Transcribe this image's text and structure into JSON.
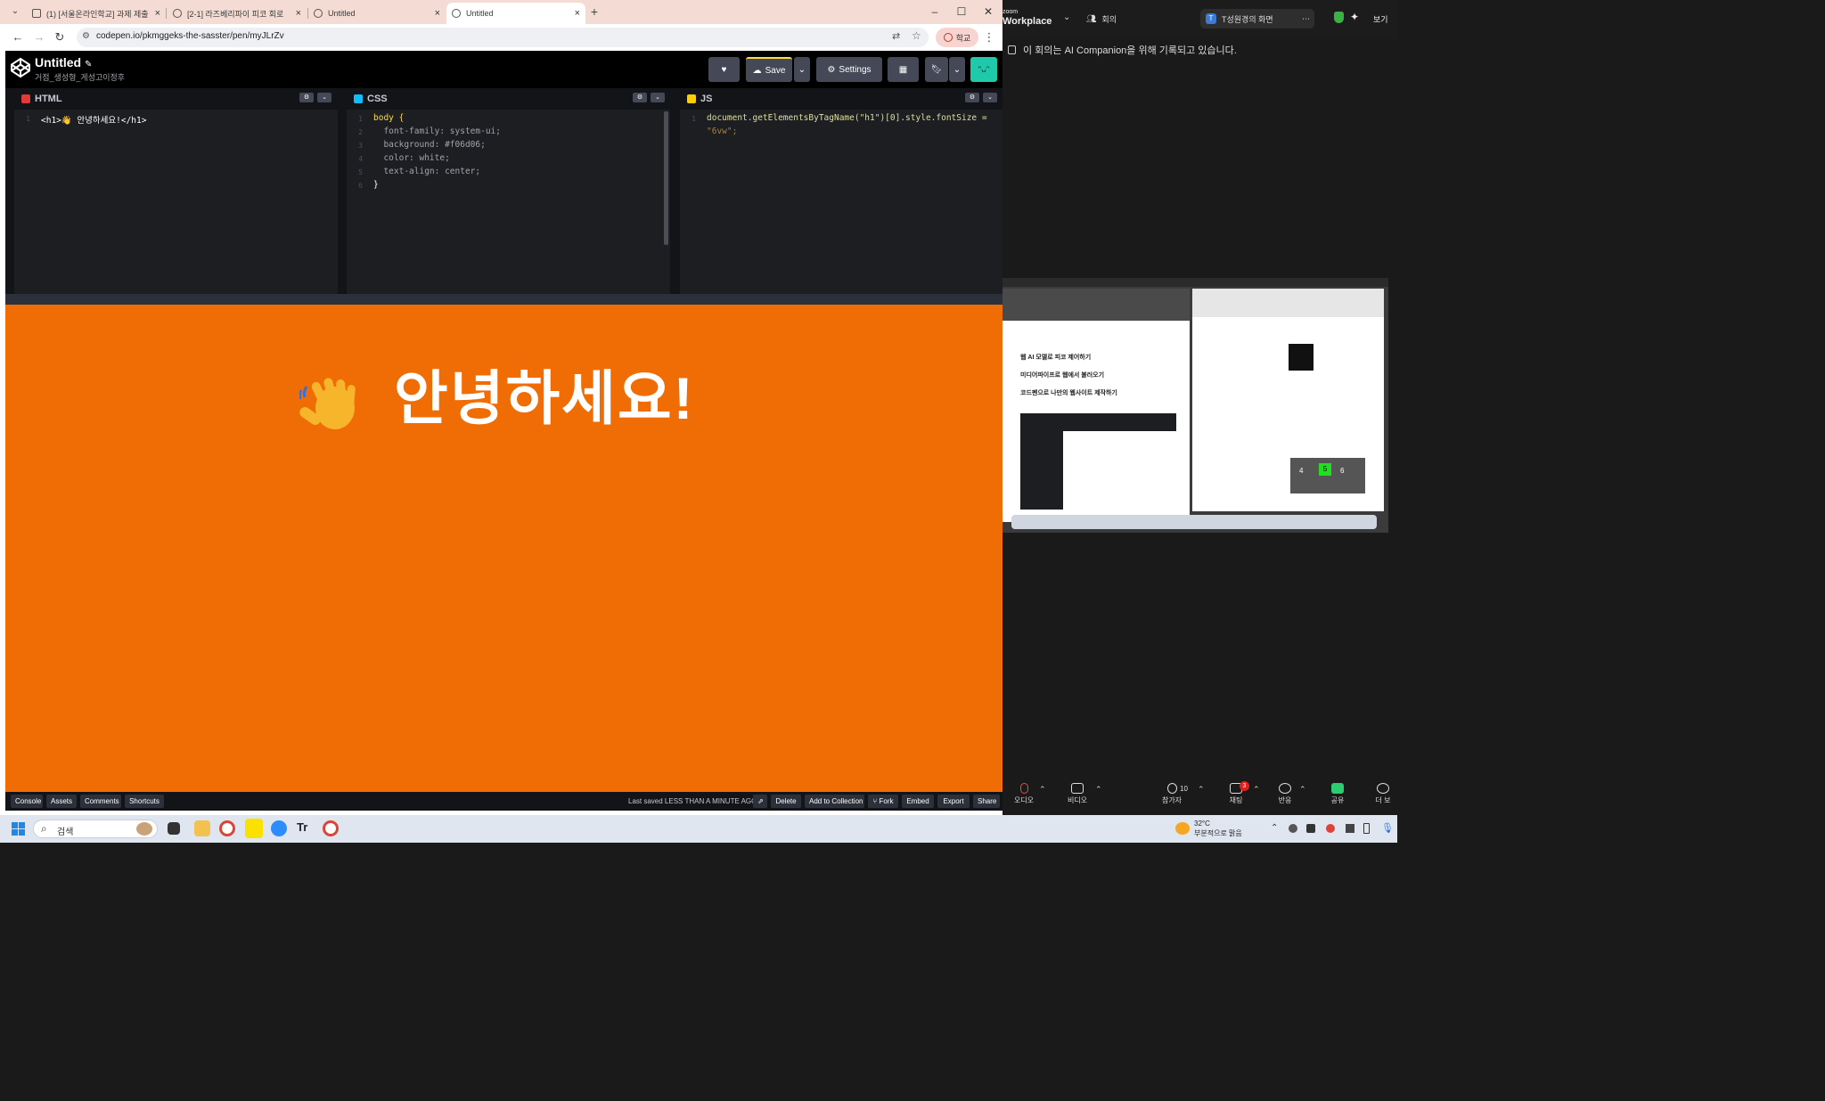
{
  "browser": {
    "tabs": [
      {
        "label": "(1) [서울온라인학교] 과제 제출"
      },
      {
        "label": "[2-1] 라즈베리파이 피코 회로"
      },
      {
        "label": "Untitled"
      },
      {
        "label": "Untitled"
      }
    ],
    "new_tab": "+",
    "url": "codepen.io/pkmggeks-the-sasster/pen/myJLrZv",
    "profile_label": "학교"
  },
  "codepen": {
    "title": "Untitled",
    "author": "거점_생성형_게성고이정후",
    "save_label": "Save",
    "settings_label": "Settings",
    "editors": {
      "html": {
        "label": "HTML",
        "lines": [
          "<h1>👋 안녕하세요!</h1>"
        ]
      },
      "css": {
        "label": "CSS",
        "lines": [
          "body {",
          "  font-family: system-ui;",
          "  background: #f06d06;",
          "  color: white;",
          "  text-align: center;",
          "}"
        ]
      },
      "js": {
        "label": "JS",
        "lines": [
          "document.getElementsByTagName(\"h1\")[0].style.fontSize =",
          "\"6vw\";"
        ]
      }
    },
    "preview": {
      "heading": "안녕하세요!",
      "background": "#f06d06",
      "color": "#ffffff"
    },
    "footer": {
      "left": [
        "Console",
        "Assets",
        "Comments",
        "Shortcuts"
      ],
      "status": "Last saved LESS THAN A MINUTE AGO",
      "right": [
        "Delete",
        "Add to Collection",
        "Fork",
        "Embed",
        "Export",
        "Share"
      ]
    }
  },
  "zoom": {
    "brand_small": "zoom",
    "brand": "Workplace",
    "meeting_label": "회의",
    "share_label": "T성원경의 화면",
    "view_label": "보기",
    "banner": "이 회의는 AI Companion을 위해 기록되고 있습니다.",
    "controls": {
      "audio": "오디오",
      "video": "비디오",
      "participants": "참가자",
      "participants_count": "10",
      "chat": "채팅",
      "chat_badge": "3",
      "reactions": "반응",
      "share": "공유",
      "more": "더 보"
    },
    "shared_screen": {
      "items": [
        "웹 AI 모델로 피코 제어하기",
        "미디어파이프로 웹에서 불러오기",
        "코드펜으로 나만의 웹사이트 제작하기"
      ],
      "numbers": [
        "4",
        "5",
        "6"
      ]
    }
  },
  "taskbar": {
    "search_placeholder": "검색",
    "weather_temp": "32°C",
    "weather_desc": "부분적으로 맑음"
  }
}
